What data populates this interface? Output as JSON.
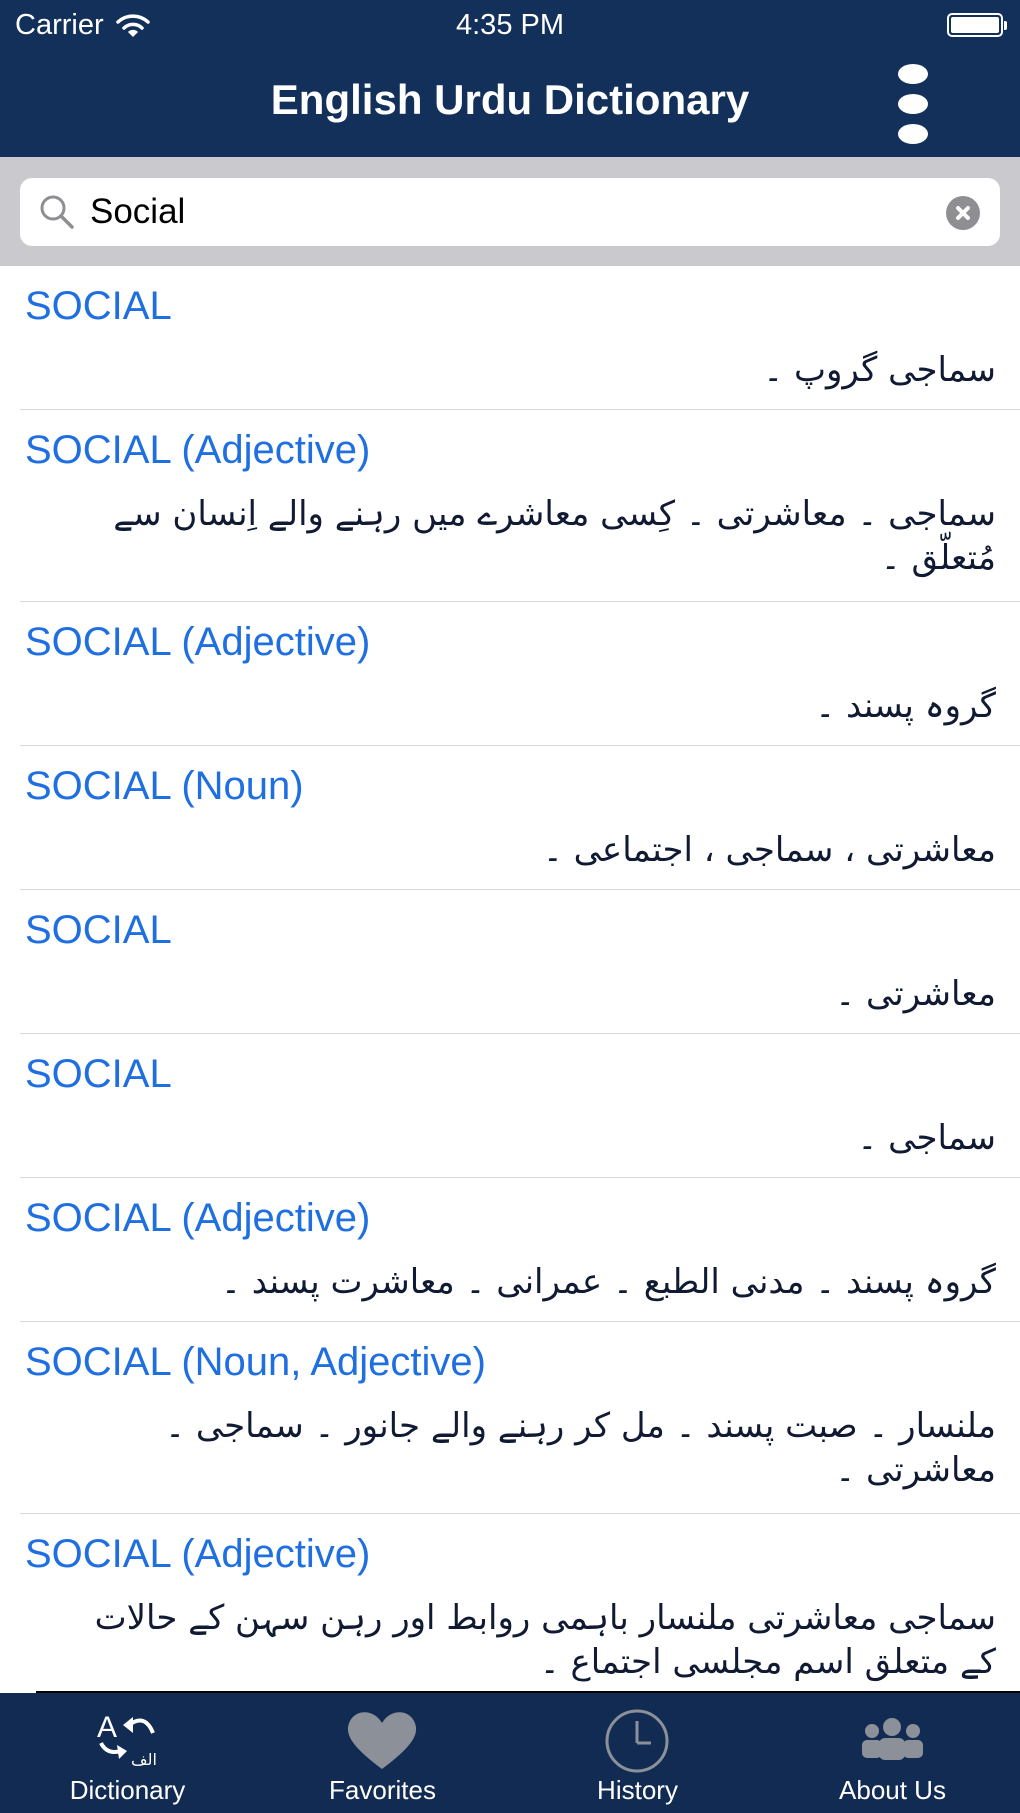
{
  "status_bar": {
    "carrier": "Carrier",
    "time": "4:35 PM"
  },
  "header": {
    "title": "English Urdu Dictionary"
  },
  "search": {
    "value": "Social"
  },
  "results": [
    {
      "title": "SOCIAL",
      "meaning": "سماجی گروپ ۔"
    },
    {
      "title": "SOCIAL (Adjective)",
      "meaning": "سماجی ۔ معاشرتی ۔ کِسی معاشرے میں رہنے والے اِنسان سے مُتعلّق ۔"
    },
    {
      "title": "SOCIAL (Adjective)",
      "meaning": "گروہ پسند ۔"
    },
    {
      "title": "SOCIAL (Noun)",
      "meaning": "معاشرتی ، سماجی ، اجتماعی ۔"
    },
    {
      "title": "SOCIAL",
      "meaning": "معاشرتی ۔"
    },
    {
      "title": "SOCIAL",
      "meaning": "سماجی ۔"
    },
    {
      "title": "SOCIAL (Adjective)",
      "meaning": "گروہ پسند ۔ مدنی الطبع ۔ عمرانی ۔ معاشرت پسند ۔"
    },
    {
      "title": "SOCIAL (Noun, Adjective)",
      "meaning": "ملنسار ۔ صبت پسند ۔ مل کر رہنے والے جانور ۔ سماجی ۔ معاشرتی ۔"
    },
    {
      "title": "SOCIAL (Adjective)",
      "meaning": "سماجی معاشرتی ملنسار باہمی روابط اور رہن سہن کے حالات کے متعلق اسم مجلسی اجتماع ۔"
    }
  ],
  "tabs": [
    {
      "label": "Dictionary",
      "icon": "dictionary-icon",
      "glyph_a": "A",
      "glyph_urdu": "الف"
    },
    {
      "label": "Favorites",
      "icon": "heart-icon"
    },
    {
      "label": "History",
      "icon": "clock-icon"
    },
    {
      "label": "About Us",
      "icon": "people-icon"
    }
  ],
  "colors": {
    "header_bg": "#123059",
    "tab_bar_bg": "#122b52",
    "entry_title": "#1f6fe0",
    "search_bar_bg": "#c9c9ce"
  }
}
